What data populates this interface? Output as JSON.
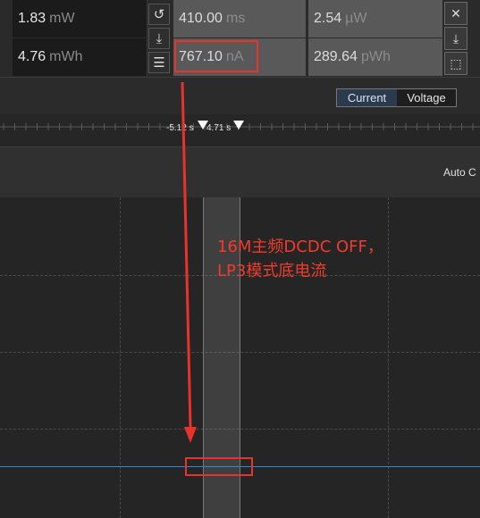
{
  "measurements": {
    "power": {
      "value": "1.83",
      "unit": "mW"
    },
    "energy": {
      "value": "4.76",
      "unit": "mWh"
    },
    "duration": {
      "value": "410.00",
      "unit": "ms"
    },
    "avg_current": {
      "value": "767.10",
      "unit": "nA"
    },
    "avg_power": {
      "value": "2.54",
      "unit": "µW"
    },
    "sel_energy": {
      "value": "289.64",
      "unit": "pWh"
    }
  },
  "icons": {
    "reset": "reset-icon",
    "download": "download-icon",
    "list": "list-icon",
    "close": "close-icon",
    "download2": "download-icon",
    "screenshot": "screenshot-icon"
  },
  "toolbar": {
    "current_label": "Current",
    "voltage_label": "Voltage"
  },
  "timeline": {
    "left_marker": "-5.12 s",
    "right_marker": "4.71 s"
  },
  "plot": {
    "auto_label": "Auto C"
  },
  "annotation": {
    "text": "16M主频DCDC OFF，\nLP3模式底电流"
  },
  "colors": {
    "signal": "#2e8ad8",
    "highlight": "#e8322c",
    "annotation": "#f03c2c"
  }
}
